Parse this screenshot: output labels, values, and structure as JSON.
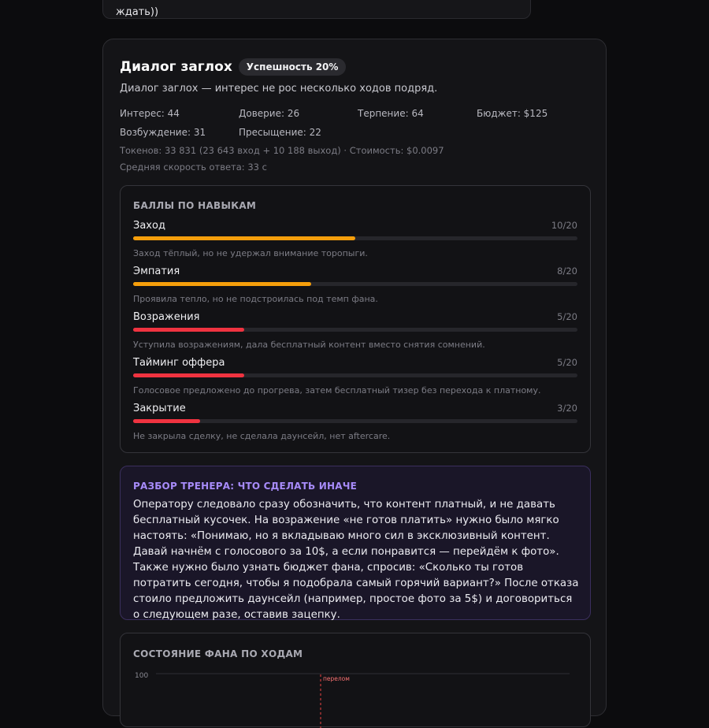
{
  "previous_message": {
    "text": "ждать))"
  },
  "result": {
    "title": "Диалог заглох",
    "badge": "Успешность 20%",
    "subtitle": "Диалог заглох — интерес не рос несколько ходов подряд.",
    "stats": [
      {
        "label": "Интерес: 44"
      },
      {
        "label": "Доверие: 26"
      },
      {
        "label": "Терпение: 64"
      },
      {
        "label": "Бюджет: $125"
      },
      {
        "label": "Возбуждение: 31"
      },
      {
        "label": "Пресыщение: 22"
      }
    ],
    "tokens": "Токенов: 33 831 (23 643 вход + 10 188 выход) · Стоимость: $0.0097",
    "avg_speed": "Средняя скорость ответа: 33 с"
  },
  "skills": {
    "title": "БАЛЛЫ ПО НАВЫКАМ",
    "items": [
      {
        "name": "Заход",
        "score": "10/20",
        "fraction": 0.5,
        "color": "#f59e0b",
        "note": "Заход тёплый, но не удержал внимание торопыги."
      },
      {
        "name": "Эмпатия",
        "score": "8/20",
        "fraction": 0.4,
        "color": "#f59e0b",
        "note": "Проявила тепло, но не подстроилась под темп фана."
      },
      {
        "name": "Возражения",
        "score": "5/20",
        "fraction": 0.25,
        "color": "#ef3340",
        "note": "Уступила возражениям, дала бесплатный контент вместо снятия сомнений."
      },
      {
        "name": "Тайминг оффера",
        "score": "5/20",
        "fraction": 0.25,
        "color": "#ef3340",
        "note": "Голосовое предложено до прогрева, затем бесплатный тизер без перехода к платному."
      },
      {
        "name": "Закрытие",
        "score": "3/20",
        "fraction": 0.15,
        "color": "#ef3340",
        "note": "Не закрыла сделку, не сделала даунсейл, нет aftercare."
      }
    ]
  },
  "coach": {
    "title": "РАЗБОР ТРЕНЕРА: ЧТО СДЕЛАТЬ ИНАЧЕ",
    "text": "Оператору следовало сразу обозначить, что контент платный, и не давать бесплатный кусочек. На возражение «не готов платить» нужно было мягко настоять: «Понимаю, но я вкладываю много сил в эксклюзивный контент. Давай начнём с голосового за 10$, а если понравится — перейдём к фото». Также нужно было узнать бюджет фана, спросив: «Сколько ты готов потратить сегодня, чтобы я подобрала самый горячий вариант?» После отказа стоило предложить даунсейл (например, простое фото за 5$) и договориться о следующем разе, оставив зацепку."
  },
  "fan_state": {
    "title": "СОСТОЯНИЕ ФАНА ПО ХОДАМ",
    "y_tick_top": "100",
    "marker_label": "перелом"
  },
  "colors": {
    "accent_purple": "#a78bfa",
    "warn": "#f59e0b",
    "bad": "#ef3340"
  }
}
